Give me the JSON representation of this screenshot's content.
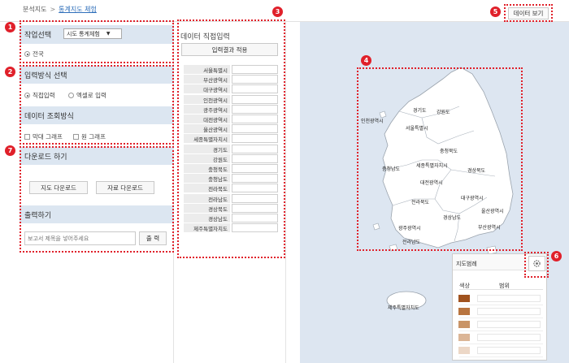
{
  "breadcrumb": {
    "root": "분석지도",
    "separator": ">",
    "current": "통계지도 체험"
  },
  "callouts": [
    "1",
    "2",
    "3",
    "4",
    "5",
    "6",
    "7"
  ],
  "left_panel": {
    "work_select": {
      "title": "작업선택",
      "select_value": "시도 통계체험",
      "radio_label": "전국"
    },
    "input_method": {
      "title": "입력방식 선택",
      "option_direct": "직접입력",
      "option_excel": "엑셀로 입력"
    },
    "view_method": {
      "title": "데이터 조회방식",
      "option_bar": "막대 그래프",
      "option_pie": "원 그래프"
    },
    "download": {
      "title": "다운로드 하기",
      "map_button": "지도 다운로드",
      "data_button": "자료 다운로드"
    },
    "print": {
      "title": "출력하기",
      "placeholder": "보고서 제목을 넣어주세요",
      "button": "출 력"
    }
  },
  "middle_panel": {
    "title": "데이터 직접입력",
    "apply_button": "입력결과 적용",
    "regions": [
      "서울특별시",
      "부산광역시",
      "대구광역시",
      "인천광역시",
      "광주광역시",
      "대전광역시",
      "울산광역시",
      "세종특별자치시",
      "경기도",
      "강원도",
      "충청북도",
      "충청남도",
      "전라북도",
      "전라남도",
      "경상북도",
      "경상남도",
      "제주특별자치도"
    ]
  },
  "map": {
    "view_data_button": "데이터 보기",
    "labels": {
      "gyeonggi": "경기도",
      "gangwon": "강원도",
      "incheon": "인천광역시",
      "seoul": "서울특별시",
      "chungbuk": "충청북도",
      "chungnam": "충청남도",
      "sejong": "세종특별자치시",
      "daejeon": "대전광역시",
      "gyeongbuk": "경상북도",
      "jeonbuk": "전라북도",
      "daegu": "대구광역시",
      "ulsan": "울산광역시",
      "gyeongnam": "경상남도",
      "gwangju": "광주광역시",
      "busan": "부산광역시",
      "jeonnam": "전라남도",
      "jeju": "제주특별자치도"
    },
    "legend": {
      "title": "지도범례",
      "col_color": "색상",
      "col_range": "범위",
      "colors": [
        "#a0521e",
        "#b8743f",
        "#c99467",
        "#dbb596",
        "#ecd7c6"
      ]
    },
    "icons": {
      "settings": "gear-icon"
    }
  }
}
